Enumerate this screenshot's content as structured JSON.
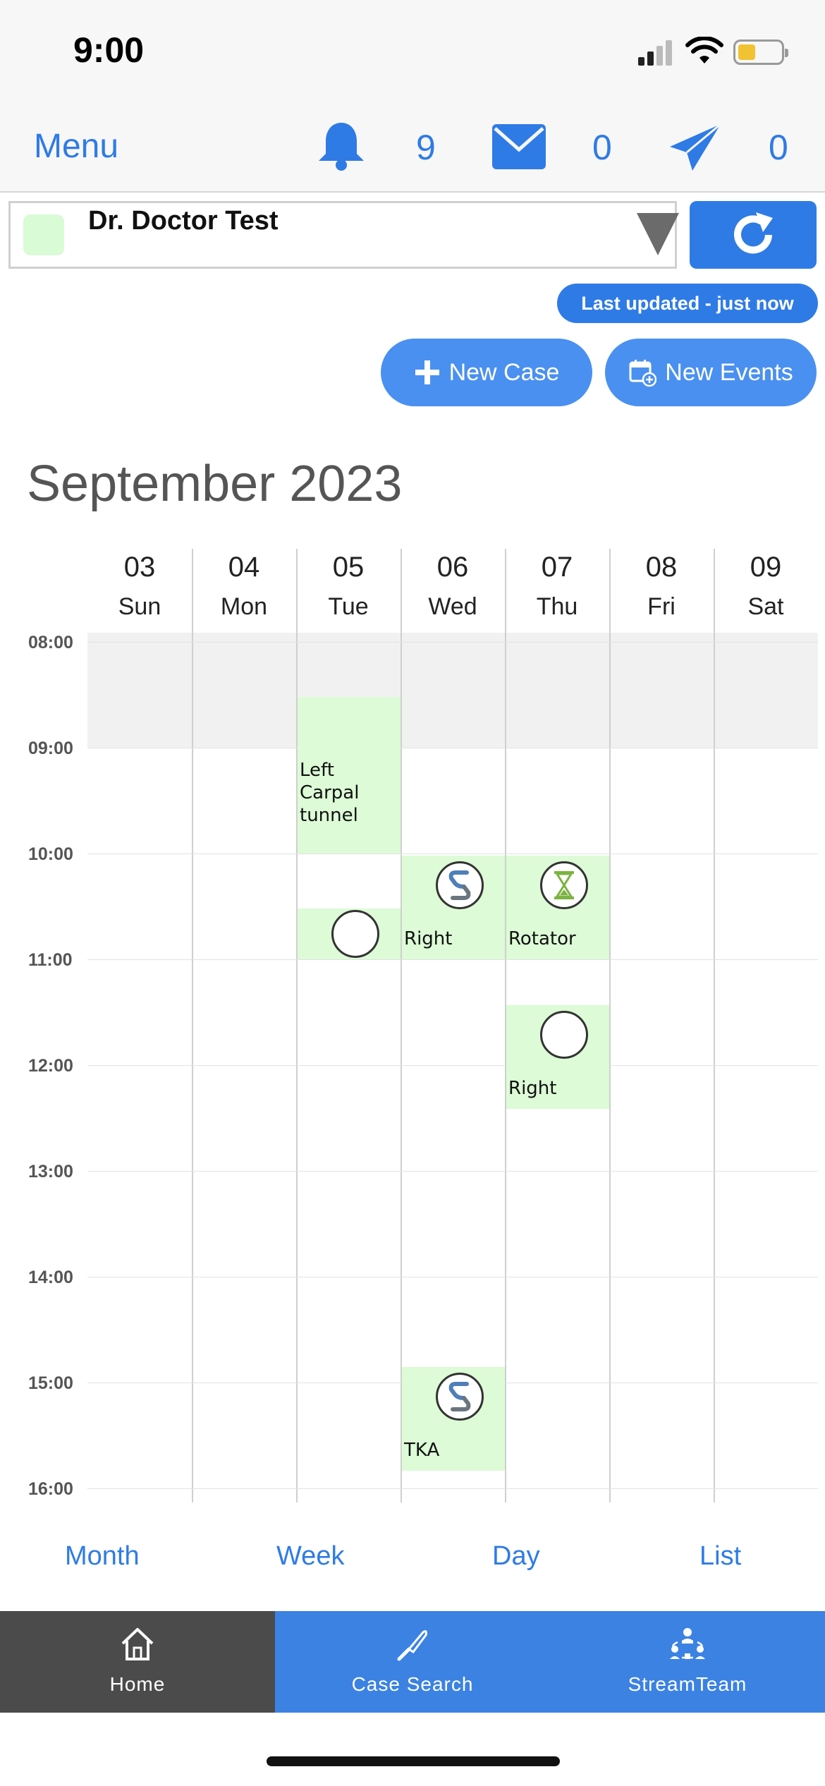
{
  "status_bar": {
    "time": "9:00",
    "battery_color": "#f1c232"
  },
  "nav": {
    "menu_label": "Menu",
    "notifications": {
      "icon": "bell-icon",
      "count": "9"
    },
    "messages": {
      "icon": "envelope-icon",
      "count": "0"
    },
    "sent": {
      "icon": "paper-plane-icon",
      "count": "0"
    },
    "accent_color": "#2f7be6"
  },
  "doctor_selector": {
    "selected": "Dr. Doctor Test",
    "swatch_color": "#d9fbd6"
  },
  "last_updated": "Last updated - just now",
  "actions": {
    "new_case": "New Case",
    "new_events": "New Events"
  },
  "calendar": {
    "month_title": "September 2023",
    "days": [
      {
        "num": "03",
        "name": "Sun"
      },
      {
        "num": "04",
        "name": "Mon"
      },
      {
        "num": "05",
        "name": "Tue"
      },
      {
        "num": "06",
        "name": "Wed"
      },
      {
        "num": "07",
        "name": "Thu"
      },
      {
        "num": "08",
        "name": "Fri"
      },
      {
        "num": "09",
        "name": "Sat"
      }
    ],
    "hours": [
      "08:00",
      "09:00",
      "10:00",
      "11:00",
      "12:00",
      "13:00",
      "14:00",
      "15:00",
      "16:00"
    ],
    "events": [
      {
        "day": "Tue",
        "title": "Left Carpal tunnel",
        "icon": "none"
      },
      {
        "day": "Tue",
        "title": "",
        "icon": "empty-circle-icon"
      },
      {
        "day": "Wed",
        "title": "Right",
        "icon": "s-logo-icon"
      },
      {
        "day": "Thu",
        "title": "Rotator",
        "icon": "hourglass-icon"
      },
      {
        "day": "Thu",
        "title": "Right",
        "icon": "empty-circle-icon"
      },
      {
        "day": "Wed",
        "title": "TKA",
        "icon": "s-logo-icon"
      }
    ],
    "event_color": "#dcfbd6"
  },
  "view_tabs": {
    "month": "Month",
    "week": "Week",
    "day": "Day",
    "list": "List"
  },
  "tab_bar": {
    "home": "Home",
    "case_search": "Case Search",
    "stream_team": "StreamTeam"
  }
}
